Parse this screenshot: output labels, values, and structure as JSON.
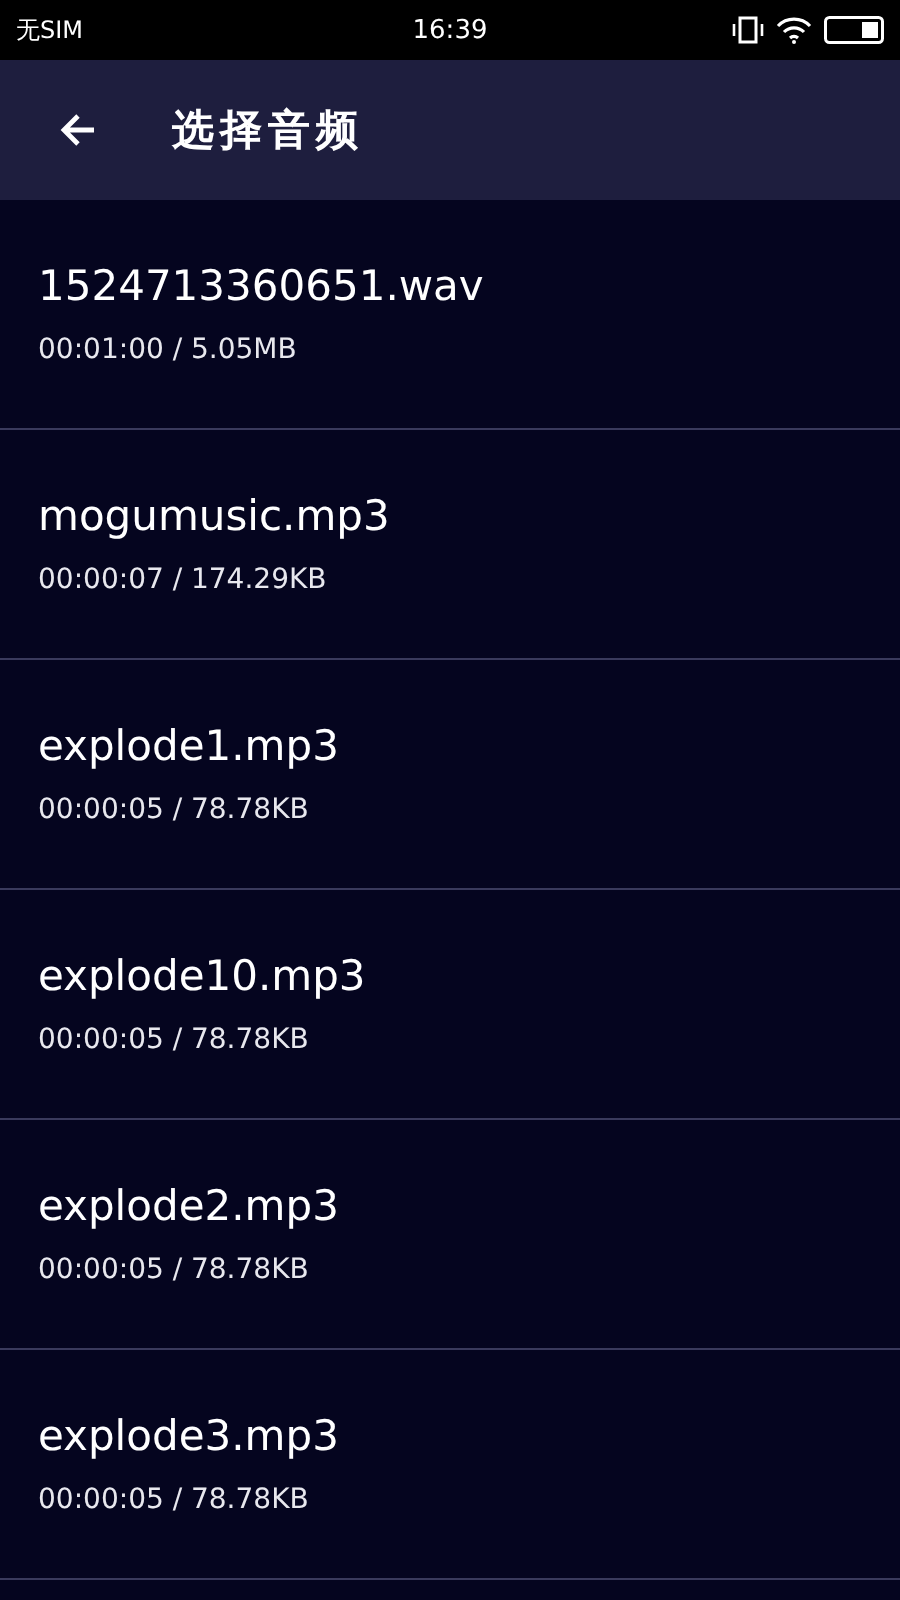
{
  "status_bar": {
    "carrier": "无SIM",
    "time": "16:39"
  },
  "header": {
    "title": "选择音频"
  },
  "files": [
    {
      "name": "1524713360651.wav",
      "info": "00:01:00 / 5.05MB"
    },
    {
      "name": "mogumusic.mp3",
      "info": "00:00:07 / 174.29KB"
    },
    {
      "name": "explode1.mp3",
      "info": "00:00:05 / 78.78KB"
    },
    {
      "name": "explode10.mp3",
      "info": "00:00:05 / 78.78KB"
    },
    {
      "name": "explode2.mp3",
      "info": "00:00:05 / 78.78KB"
    },
    {
      "name": "explode3.mp3",
      "info": "00:00:05 / 78.78KB"
    }
  ]
}
